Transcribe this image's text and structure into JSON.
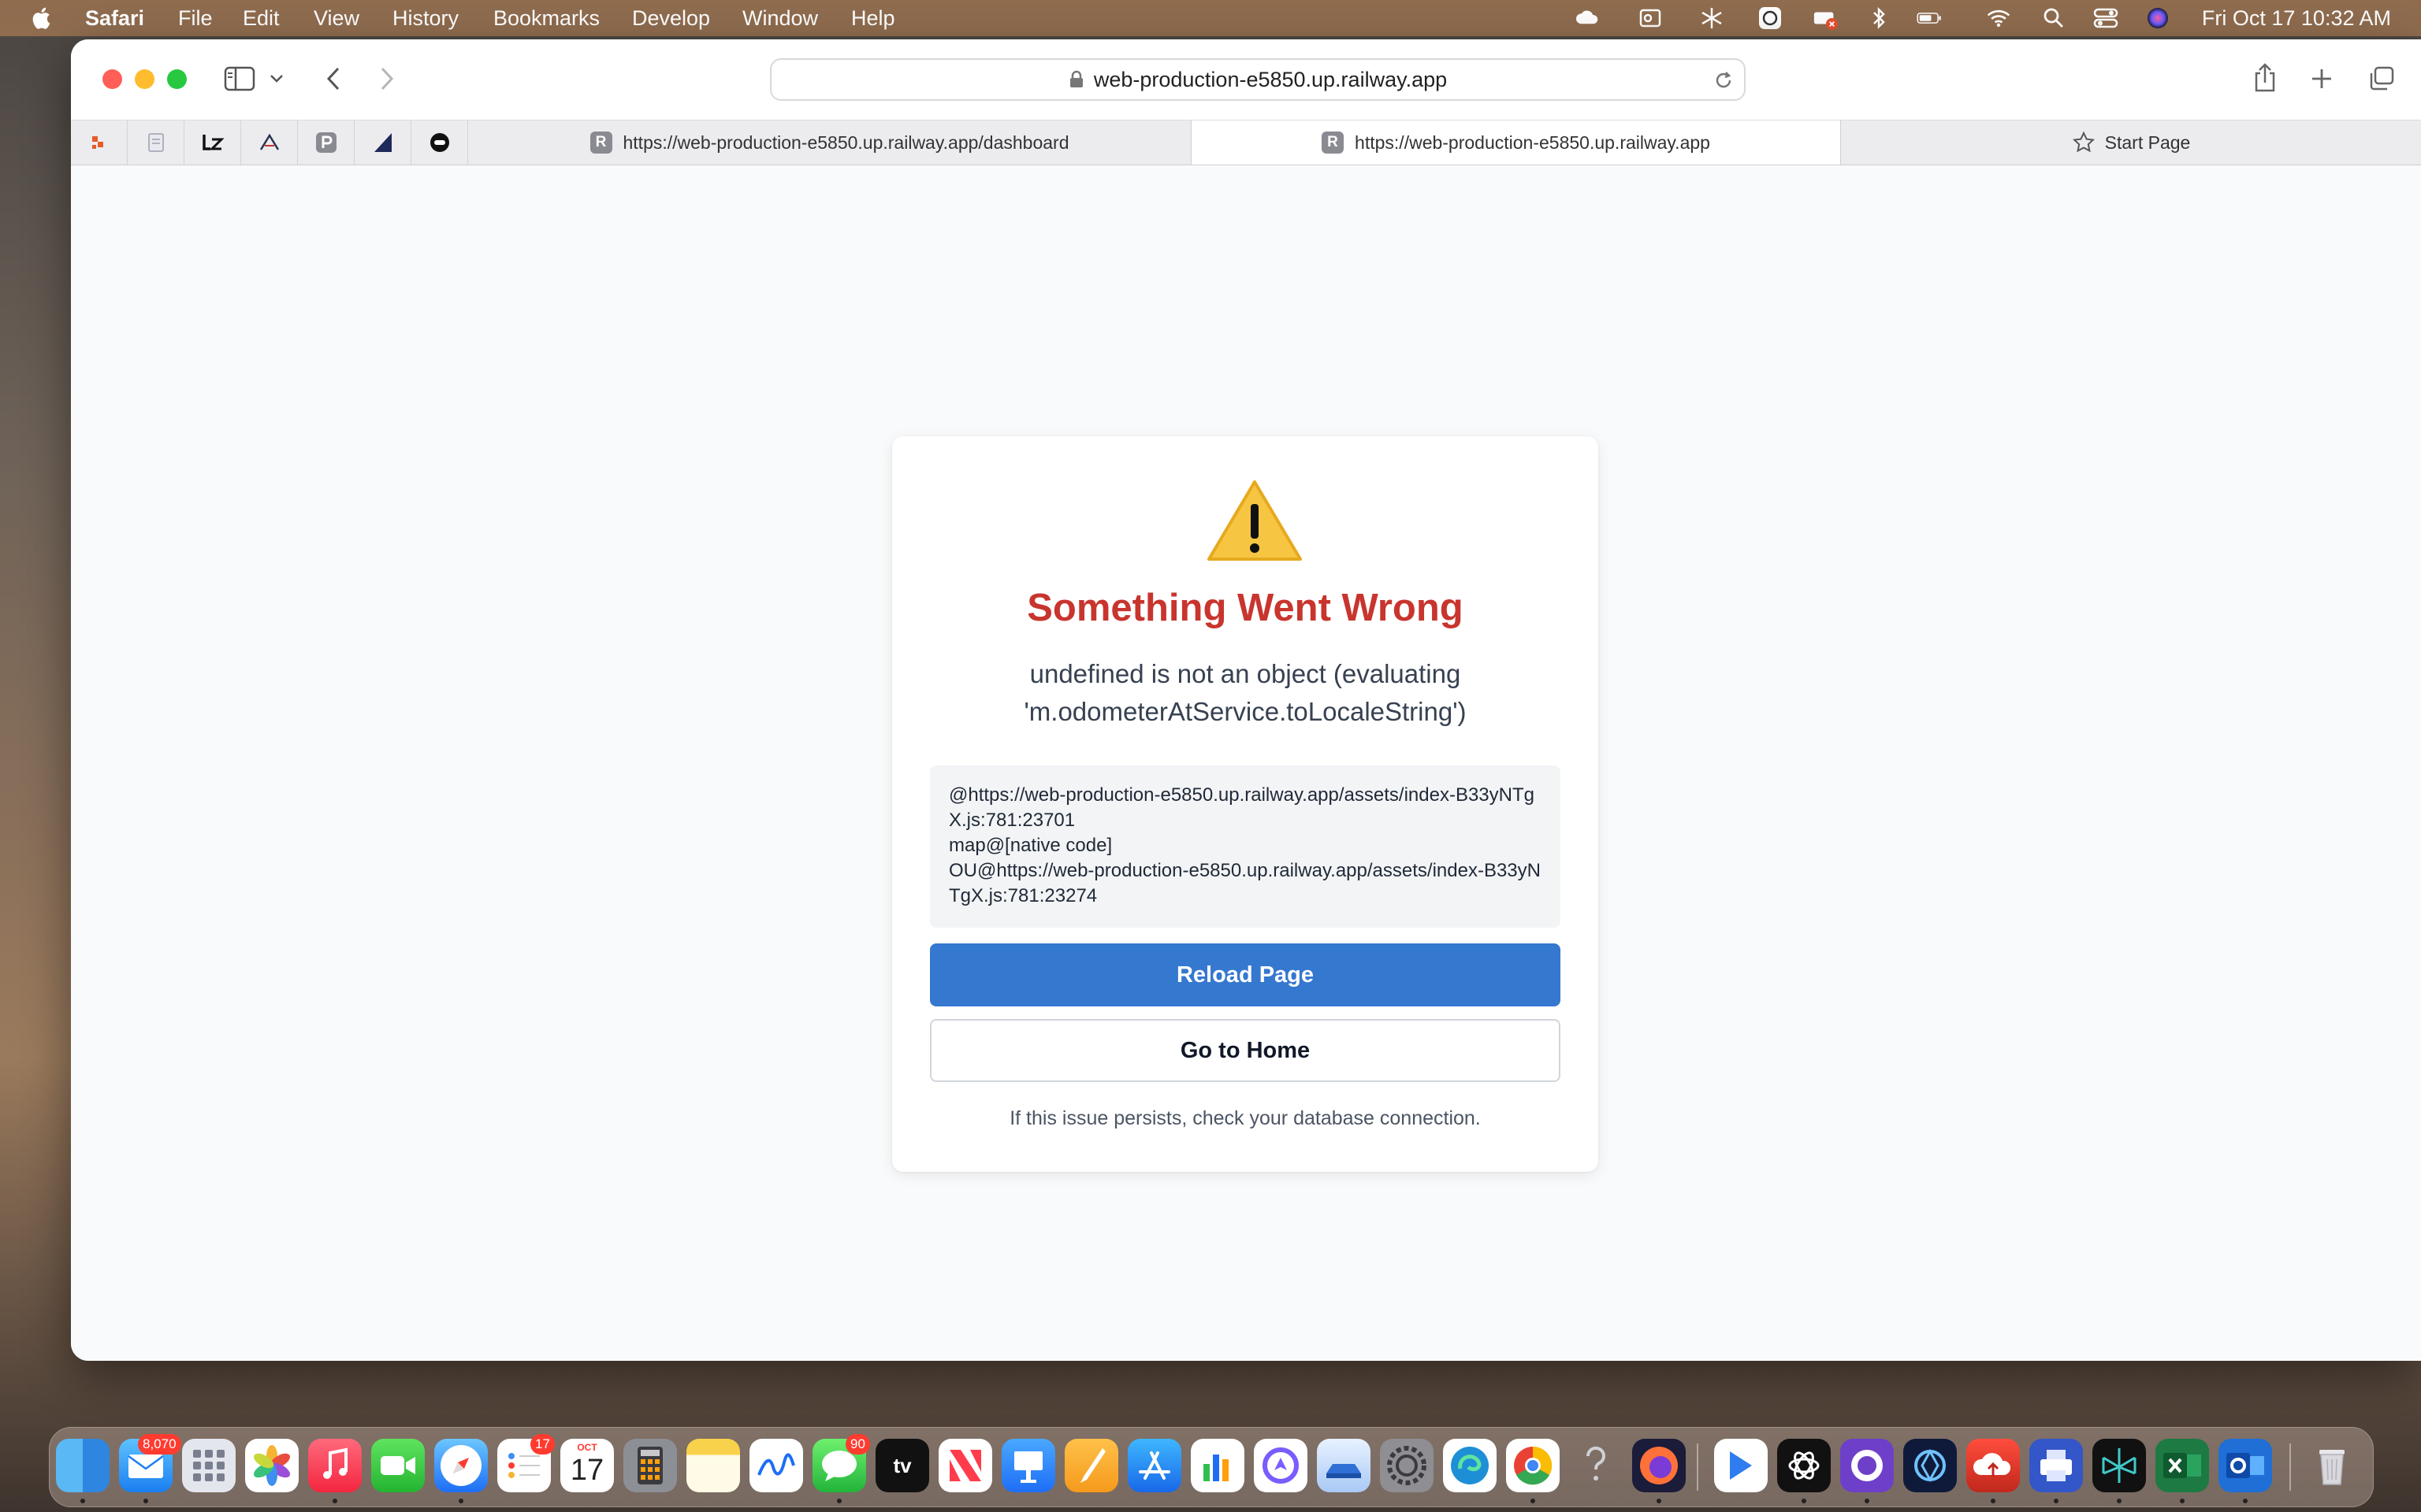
{
  "menubar": {
    "app_name": "Safari",
    "items": [
      "File",
      "Edit",
      "View",
      "History",
      "Bookmarks",
      "Develop",
      "Window",
      "Help"
    ],
    "clock": "Fri Oct 17  10:32 AM"
  },
  "browser": {
    "url": "web-production-e5850.up.railway.app",
    "tabs": [
      {
        "label": "https://web-production-e5850.up.railway.app/dashboard",
        "favicon": "R",
        "active": false
      },
      {
        "label": "https://web-production-e5850.up.railway.app",
        "favicon": "R",
        "active": true
      },
      {
        "label": "Start Page",
        "favicon": "star-icon",
        "active": false
      }
    ]
  },
  "error": {
    "title": "Something Went Wrong",
    "message": "undefined is not an object (evaluating 'm.odometerAtService.toLocaleString')",
    "stack": "@https://web-production-e5850.up.railway.app/assets/index-B33yNTgX.js:781:23701\nmap@[native code]\nOU@https://web-production-e5850.up.railway.app/assets/index-B33yNTgX.js:781:23274",
    "reload_label": "Reload Page",
    "home_label": "Go to Home",
    "hint": "If this issue persists, check your database connection."
  },
  "dock": {
    "mail_badge": "8,070",
    "reminders_badge": "17",
    "calendar_month": "OCT",
    "calendar_day": "17",
    "messages_badge": "90",
    "tv_label": "tv"
  },
  "colors": {
    "error_title": "#c8352e",
    "primary_button": "#3578cf",
    "stack_background": "#f3f4f6"
  }
}
